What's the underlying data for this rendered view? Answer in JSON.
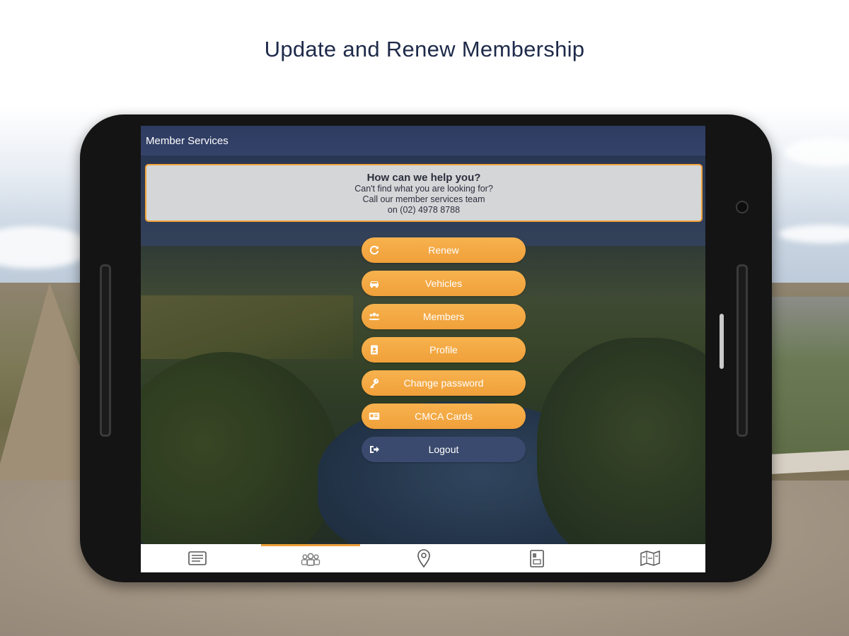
{
  "headline": "Update and Renew Membership",
  "app": {
    "title": "Member Services"
  },
  "help": {
    "title": "How can we help you?",
    "lines": [
      "Can't find what you are looking for?",
      "Call our member services team",
      "on (02) 4978 8788"
    ]
  },
  "menu": [
    {
      "label": "Renew",
      "icon": "refresh-icon"
    },
    {
      "label": "Vehicles",
      "icon": "car-icon"
    },
    {
      "label": "Members",
      "icon": "users-icon"
    },
    {
      "label": "Profile",
      "icon": "id-badge-icon"
    },
    {
      "label": "Change password",
      "icon": "key-icon"
    },
    {
      "label": "CMCA Cards",
      "icon": "card-icon"
    },
    {
      "label": "Logout",
      "icon": "logout-icon"
    }
  ],
  "tabs": [
    {
      "icon": "list-icon",
      "active": false
    },
    {
      "icon": "members-icon",
      "active": true
    },
    {
      "icon": "map-pin-icon",
      "active": false
    },
    {
      "icon": "book-icon",
      "active": false
    },
    {
      "icon": "map-icon",
      "active": false
    }
  ],
  "colors": {
    "accent": "#f0a03a",
    "navy": "#2e3c61",
    "logout_button": "#3a4a6e",
    "help_box": "#d5d6d8"
  }
}
